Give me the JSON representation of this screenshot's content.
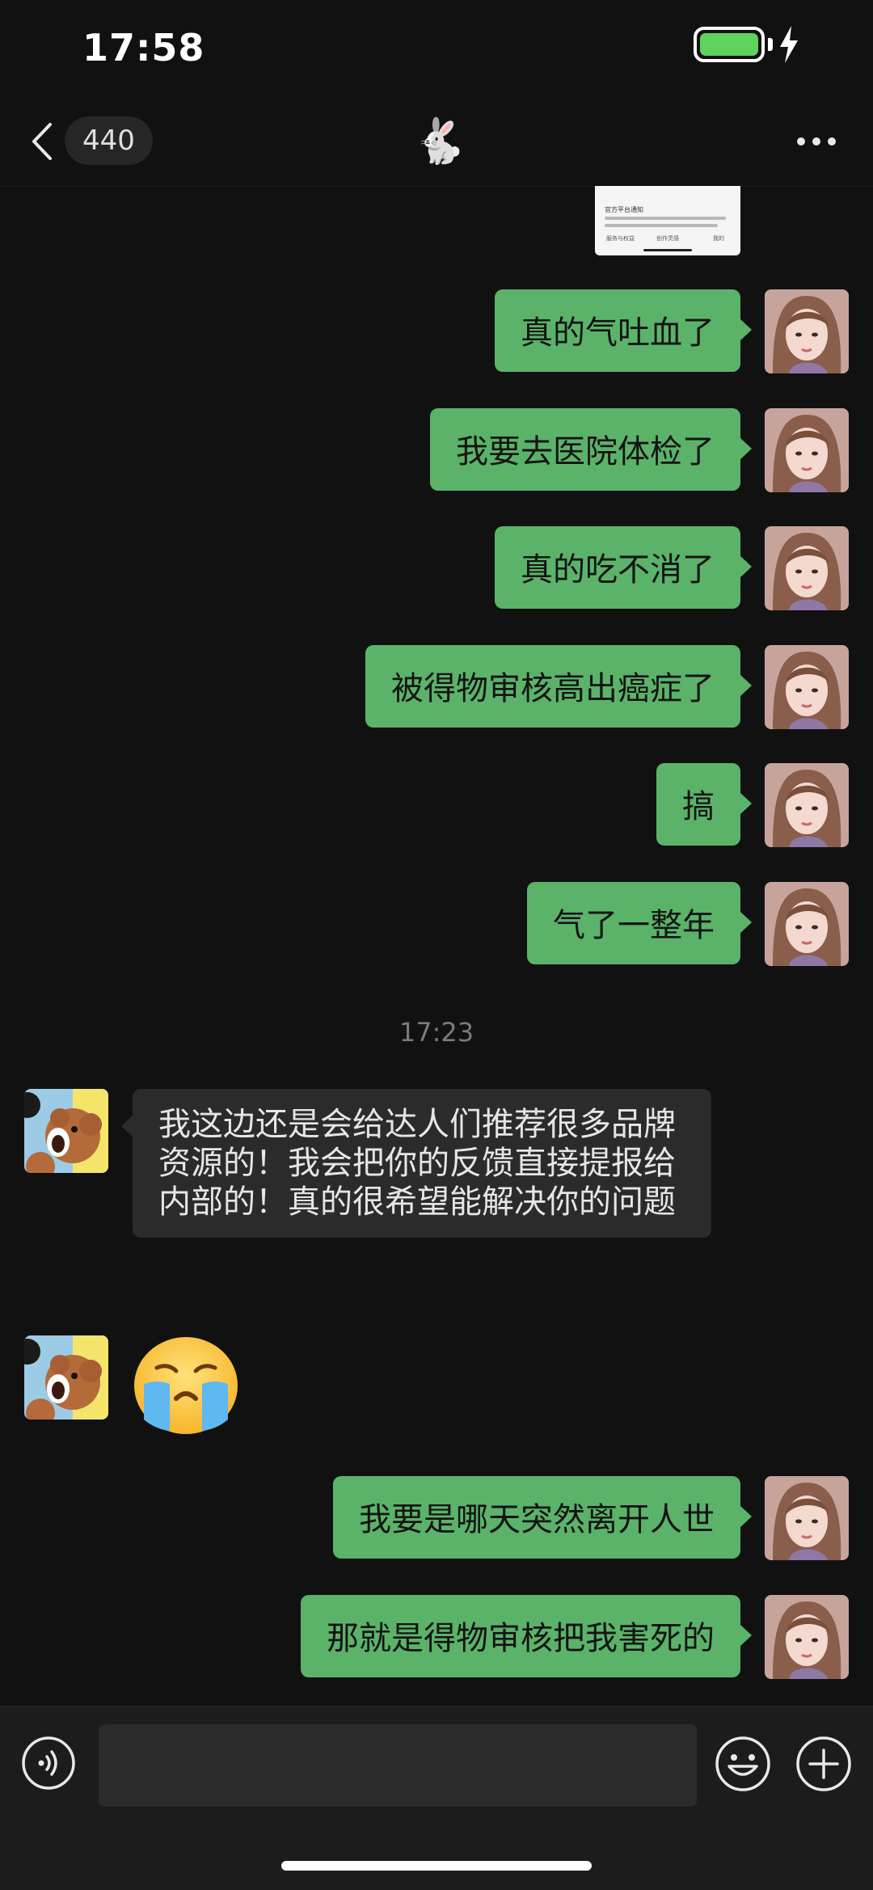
{
  "status_bar": {
    "time": "17:58",
    "battery": "full",
    "charging": true
  },
  "nav": {
    "unread_count": "440",
    "title": "🐇"
  },
  "preview_card": {
    "title": "官方平台通知",
    "options": [
      "服务与权益",
      "创作灵感",
      "我的"
    ]
  },
  "messages": [
    {
      "side": "out",
      "text": "真的气吐血了"
    },
    {
      "side": "out",
      "text": "我要去医院体检了"
    },
    {
      "side": "out",
      "text": "真的吃不消了"
    },
    {
      "side": "out",
      "text": "被得物审核高出癌症了"
    },
    {
      "side": "out",
      "text": "搞"
    },
    {
      "side": "out",
      "text": "气了一整年"
    },
    {
      "side": "divider",
      "text": "17:23"
    },
    {
      "side": "in",
      "text": "我这边还是会给达人们推荐很多品牌资源的！我会把你的反馈直接提报给内部的！真的很希望能解决你的问题"
    },
    {
      "side": "in",
      "emoji": "loudly-crying-face"
    },
    {
      "side": "out",
      "text": "我要是哪天突然离开人世"
    },
    {
      "side": "out",
      "text": "那就是得物审核把我害死的"
    }
  ],
  "input": {
    "placeholder": ""
  },
  "colors": {
    "background": "#111111",
    "outgoing_bubble": "#5bb36a",
    "incoming_bubble": "#2b2b2b",
    "input_bar": "#1c1c1c",
    "battery": "#5fd35b"
  }
}
